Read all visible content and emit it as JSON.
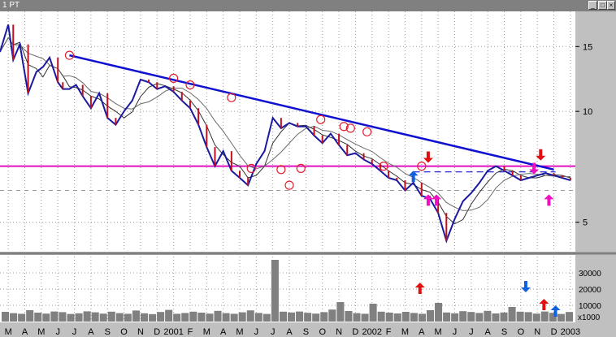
{
  "window": {
    "title": "1 PT"
  },
  "colors": {
    "price": "#1a1aa0",
    "down": "#c01020",
    "ma_short": "#303030",
    "ma_long": "#6a6a6a",
    "trendline": "#1010d0",
    "support": "#e010c0",
    "volume": "#808080",
    "grid": "#9a9a9a",
    "up_arrow": "#1060e0",
    "sell_arrow": "#e01010",
    "buy_arrow": "#f010c0"
  },
  "chart_data": [
    {
      "type": "line",
      "panel": "price",
      "scale": "log",
      "ylim": [
        4.2,
        18.5
      ],
      "yticks": [
        5,
        10,
        15
      ],
      "x_tick_labels": [
        "M",
        "A",
        "M",
        "J",
        "J",
        "A",
        "S",
        "O",
        "N",
        "D",
        "2001",
        "F",
        "M",
        "A",
        "M",
        "J",
        "J",
        "A",
        "S",
        "O",
        "N",
        "D",
        "2002",
        "F",
        "M",
        "A",
        "M",
        "J",
        "J",
        "A",
        "S",
        "O",
        "N",
        "D",
        "2003"
      ],
      "x_range": [
        0,
        34.8
      ],
      "grid": true,
      "series": [
        {
          "x": [
            0,
            0.5,
            0.8,
            1.2,
            1.7,
            2.2,
            2.6,
            3,
            3.5,
            3.8,
            4.2,
            4.6,
            5,
            5.5,
            6,
            6.5,
            7,
            7.5,
            8,
            8.5,
            9,
            9.5,
            10,
            10.5,
            11,
            11.5,
            12,
            12.5,
            13,
            13.5,
            14,
            14.5,
            15,
            15.5,
            16,
            16.5,
            17,
            17.5,
            18,
            18.5,
            19,
            19.5,
            20,
            20.5,
            21,
            21.5,
            22,
            22.5,
            23,
            23.5,
            24,
            24.5,
            25,
            25.5,
            26,
            26.5,
            27,
            27.5,
            28,
            28.5,
            29,
            29.5,
            30,
            30.5,
            31,
            31.5,
            32,
            32.5,
            33,
            33.5,
            34,
            34.5
          ],
          "values": [
            14.5,
            17.2,
            13.8,
            15.2,
            11.2,
            12.8,
            13.2,
            14,
            12,
            11.5,
            11.5,
            11.8,
            11,
            10.2,
            11.2,
            9.6,
            9.2,
            10,
            10.7,
            12.2,
            12,
            11.5,
            11.7,
            11.3,
            10.7,
            10.2,
            9.2,
            8,
            7.1,
            7.8,
            6.9,
            6.6,
            6.3,
            7.2,
            7.8,
            9.6,
            9.0,
            9.3,
            9.1,
            9.1,
            8.6,
            8.2,
            8.7,
            8.1,
            7.6,
            7.7,
            7.4,
            7.2,
            6.9,
            6.6,
            6.5,
            6.1,
            6.4,
            5.9,
            5.8,
            5.3,
            4.45,
            5.1,
            5.7,
            6.0,
            6.4,
            6.9,
            7.1,
            6.9,
            6.7,
            6.5,
            6.6,
            6.7,
            6.8,
            6.7,
            6.6,
            6.5
          ]
        }
      ],
      "trendline": {
        "x": [
          4.2,
          33.5
        ],
        "values": [
          14.2,
          6.95
        ]
      },
      "support_level": 7.1,
      "resistance_level": 6.85,
      "lower_dash_level": 6.1
    },
    {
      "type": "bar",
      "panel": "volume",
      "ylabel": "x1000",
      "yticks": [
        "30000",
        "20000",
        "10000"
      ],
      "ylim": [
        0,
        40000
      ],
      "values": [
        6000,
        5200,
        4800,
        7000,
        5500,
        4900,
        6200,
        5800,
        4700,
        5100,
        6300,
        5700,
        4900,
        6100,
        5200,
        4800,
        6800,
        5100,
        4600,
        5900,
        7200,
        4800,
        5300,
        6100,
        5500,
        4900,
        6600,
        5200,
        4800,
        5700,
        6900,
        5300,
        4700,
        38000,
        6100,
        5600,
        6200,
        5400,
        4900,
        5800,
        7400,
        12000,
        6500,
        5200,
        4800,
        11000,
        6100,
        5500,
        5000,
        6000,
        5300,
        4800,
        7000,
        11500,
        5600,
        5100,
        6400,
        5900,
        5300,
        6600,
        5000,
        5600,
        9000,
        6100,
        5800,
        4900,
        6200,
        5400,
        4700,
        5900
      ]
    }
  ],
  "markers": {
    "circles": [
      [
        4.2,
        14.2
      ],
      [
        10.5,
        12.3
      ],
      [
        11.5,
        11.8
      ],
      [
        14,
        10.9
      ],
      [
        15.2,
        7.0
      ],
      [
        17,
        6.95
      ],
      [
        17.5,
        6.3
      ],
      [
        18.2,
        7.0
      ],
      [
        19.4,
        9.5
      ],
      [
        20.8,
        9.1
      ],
      [
        21.2,
        9.0
      ],
      [
        22.2,
        8.8
      ],
      [
        23.2,
        7.1
      ],
      [
        25.5,
        7.1
      ]
    ],
    "arrows": [
      {
        "panel": "price",
        "kind": "sell",
        "x": 25.9,
        "at": 7.25,
        "dir": "down"
      },
      {
        "panel": "price",
        "kind": "sell",
        "x": 32.7,
        "at": 7.35,
        "dir": "down"
      },
      {
        "panel": "price",
        "kind": "up",
        "x": 25.0,
        "at": 6.9,
        "dir": "up"
      },
      {
        "panel": "price",
        "kind": "buy",
        "x": 25.9,
        "at": 5.95,
        "dir": "up"
      },
      {
        "panel": "price",
        "kind": "buy",
        "x": 26.4,
        "at": 5.95,
        "dir": "up"
      },
      {
        "panel": "price",
        "kind": "buy",
        "x": 33.2,
        "at": 5.95,
        "dir": "up"
      },
      {
        "panel": "price",
        "kind": "buy",
        "x": 32.3,
        "at": 6.75,
        "dir": "down"
      },
      {
        "panel": "volume",
        "kind": "sell",
        "x": 25.4,
        "at": 0.6,
        "dir": "up"
      },
      {
        "panel": "volume",
        "kind": "up",
        "x": 31.8,
        "at": 0.45,
        "dir": "down"
      },
      {
        "panel": "volume",
        "kind": "sell",
        "x": 32.9,
        "at": 0.35,
        "dir": "up"
      },
      {
        "panel": "volume",
        "kind": "up",
        "x": 33.6,
        "at": 0.25,
        "dir": "up"
      }
    ]
  }
}
